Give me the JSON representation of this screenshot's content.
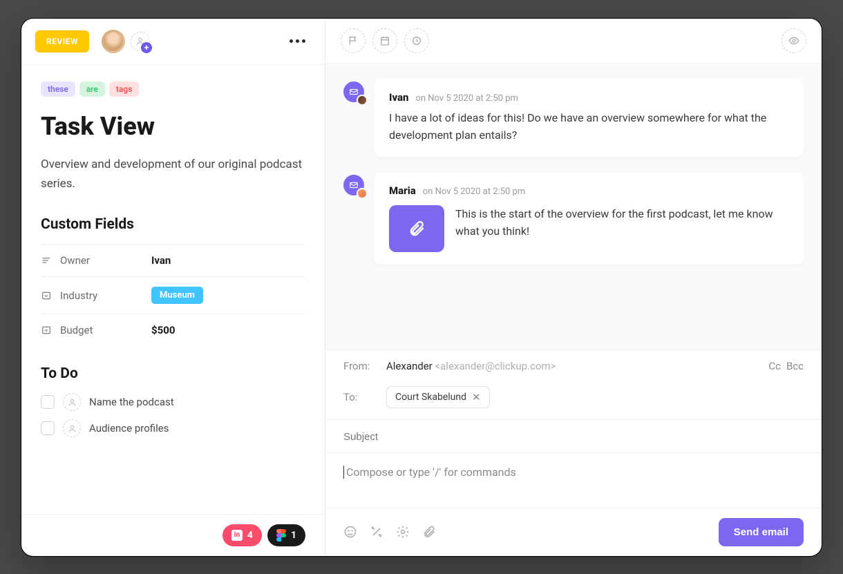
{
  "header": {
    "status_label": "REVIEW"
  },
  "tags": [
    "these",
    "are",
    "tags"
  ],
  "task": {
    "title": "Task View",
    "description": "Overview and development of our original podcast series."
  },
  "custom_fields": {
    "heading": "Custom Fields",
    "rows": [
      {
        "icon": "text",
        "label": "Owner",
        "value": "Ivan",
        "type": "text"
      },
      {
        "icon": "dropdown",
        "label": "Industry",
        "value": "Museum",
        "type": "chip"
      },
      {
        "icon": "dropdown",
        "label": "Budget",
        "value": "$500",
        "type": "text"
      }
    ]
  },
  "todo": {
    "heading": "To Do",
    "items": [
      {
        "text": "Name the podcast"
      },
      {
        "text": "Audience profiles"
      }
    ]
  },
  "footer_pills": {
    "invision_count": "4",
    "figma_count": "1"
  },
  "comments": [
    {
      "author": "Ivan",
      "meta": "on Nov 5 2020 at 2:50 pm",
      "body": "I have a lot of ideas for this! Do we have an overview somewhere for what the development plan entails?",
      "attachment": false
    },
    {
      "author": "Maria",
      "meta": "on Nov 5 2020 at 2:50 pm",
      "body": "This is the start of the overview for the first podcast, let me know what you think!",
      "attachment": true
    }
  ],
  "compose": {
    "from_label": "From:",
    "from_name": "Alexander",
    "from_email": "<alexander@clickup.com>",
    "cc": "Cc",
    "bcc": "Bcc",
    "to_label": "To:",
    "to_recipient": "Court Skabelund",
    "subject_placeholder": "Subject",
    "body_placeholder": "Compose or type '/' for commands",
    "send_label": "Send email"
  },
  "colors": {
    "accent": "#7b68ee",
    "status": "#ffc800",
    "chip": "#3fc4ff",
    "pink": "#fd4b6b"
  }
}
